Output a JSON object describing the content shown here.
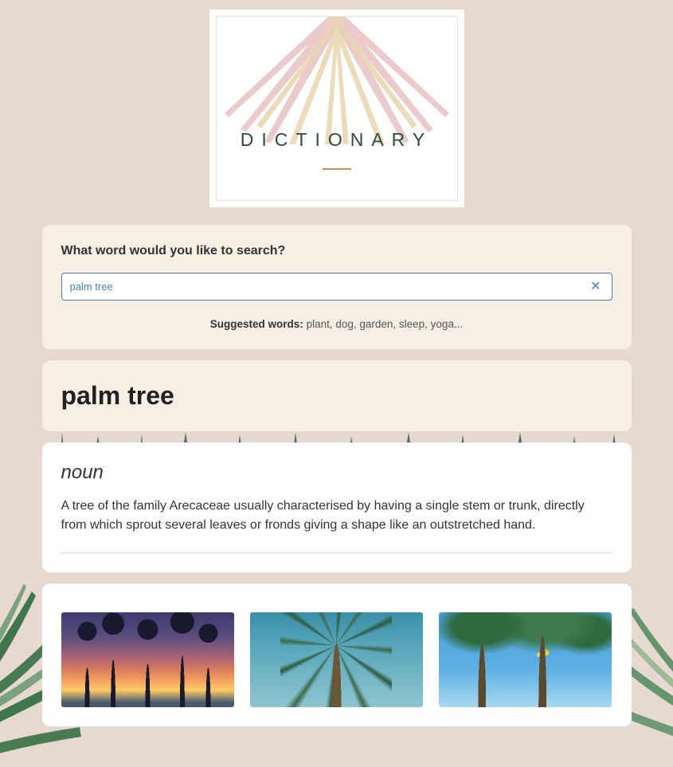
{
  "logo": {
    "title": "DICTIONARY"
  },
  "search": {
    "label": "What word would you like to search?",
    "value": "palm tree",
    "clear_icon": "✕",
    "suggestions_label": "Suggested words:",
    "suggestions_text": " plant, dog, garden, sleep, yoga..."
  },
  "result": {
    "heading": "palm tree",
    "part_of_speech": "noun",
    "definition": "A tree of the family Arecaceae usually characterised by having a single stem or trunk, directly from which sprout several leaves or fronds giving a shape like an outstretched hand."
  },
  "gallery": {
    "images": [
      {
        "name": "palm-sunset-image"
      },
      {
        "name": "palm-looking-up-image"
      },
      {
        "name": "palm-beach-image"
      }
    ]
  }
}
